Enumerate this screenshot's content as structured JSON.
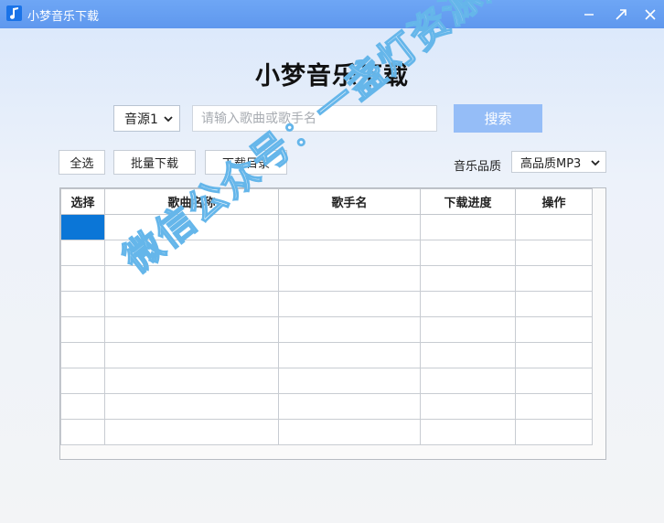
{
  "window": {
    "title": "小梦音乐下载",
    "controls": {
      "minimize": "minimize-icon",
      "maximize": "maximize-icon",
      "close": "close-icon"
    }
  },
  "header": {
    "title": "小梦音乐下载"
  },
  "search": {
    "source_value": "音源1",
    "placeholder": "请输入歌曲或歌手名",
    "value": "",
    "button_label": "搜索"
  },
  "toolbar": {
    "select_all_label": "全选",
    "batch_download_label": "批量下载",
    "download_dir_label": "下载目录",
    "quality_label": "音乐品质",
    "quality_value": "高品质MP3"
  },
  "table": {
    "columns": [
      "选择",
      "歌曲名称",
      "歌手名",
      "下载进度",
      "操作"
    ],
    "rows": 9,
    "selected_row": 0
  },
  "watermark": {
    "text": "微信公众号：一盏灯资源库"
  },
  "colors": {
    "titlebar": "#6ea6f5",
    "search_button": "#95bdf7",
    "selected_cell": "#0b76d7",
    "watermark_stroke": "#65b6ea"
  }
}
